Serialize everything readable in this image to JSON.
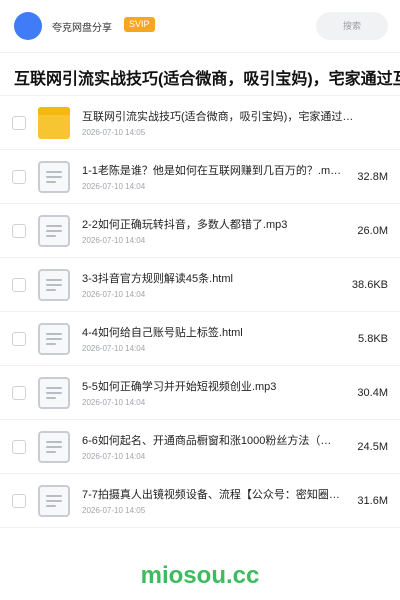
{
  "header": {
    "brand": "夸克网盘分享",
    "badge": "SVIP",
    "search_placeholder": "搜索",
    "accent": "#3f7cf5",
    "badge_color": "#f5a623"
  },
  "title": "互联网引流实战技巧(适合微商，吸引宝妈)，宅家通过互联",
  "items": [
    {
      "type": "folder",
      "icon": "folder-icon",
      "name": "互联网引流实战技巧(适合微商，吸引宝妈)，宅家通过…",
      "date": "2026-07-10 14:05",
      "size": ""
    },
    {
      "type": "file",
      "icon": "document-icon",
      "name": "1-1老陈是谁？他是如何在互联网赚到几百万的？.m…",
      "date": "2026-07-10 14:04",
      "size": "32.8M"
    },
    {
      "type": "file",
      "icon": "document-icon",
      "name": "2-2如何正确玩转抖音，多数人都错了.mp3",
      "date": "2026-07-10 14:04",
      "size": "26.0M"
    },
    {
      "type": "file",
      "icon": "document-icon",
      "name": "3-3抖音官方规则解读45条.html",
      "date": "2026-07-10 14:04",
      "size": "38.6KB"
    },
    {
      "type": "file",
      "icon": "document-icon",
      "name": "4-4如何给自己账号贴上标签.html",
      "date": "2026-07-10 14:04",
      "size": "5.8KB"
    },
    {
      "type": "file",
      "icon": "document-icon",
      "name": "5-5如何正确学习并开始短视频创业.mp3",
      "date": "2026-07-10 14:04",
      "size": "30.4M"
    },
    {
      "type": "file",
      "icon": "document-icon",
      "name": "6-6如何起名、开通商品橱窗和涨1000粉丝方法（…",
      "date": "2026-07-10 14:04",
      "size": "24.5M"
    },
    {
      "type": "file",
      "icon": "document-icon",
      "name": "7-7拍摄真人出镜视频设备、流程【公众号：密知圈】…",
      "date": "2026-07-10 14:05",
      "size": "31.6M"
    }
  ],
  "watermark": "miosou.cc",
  "watermark_color": "#3dbb5e"
}
